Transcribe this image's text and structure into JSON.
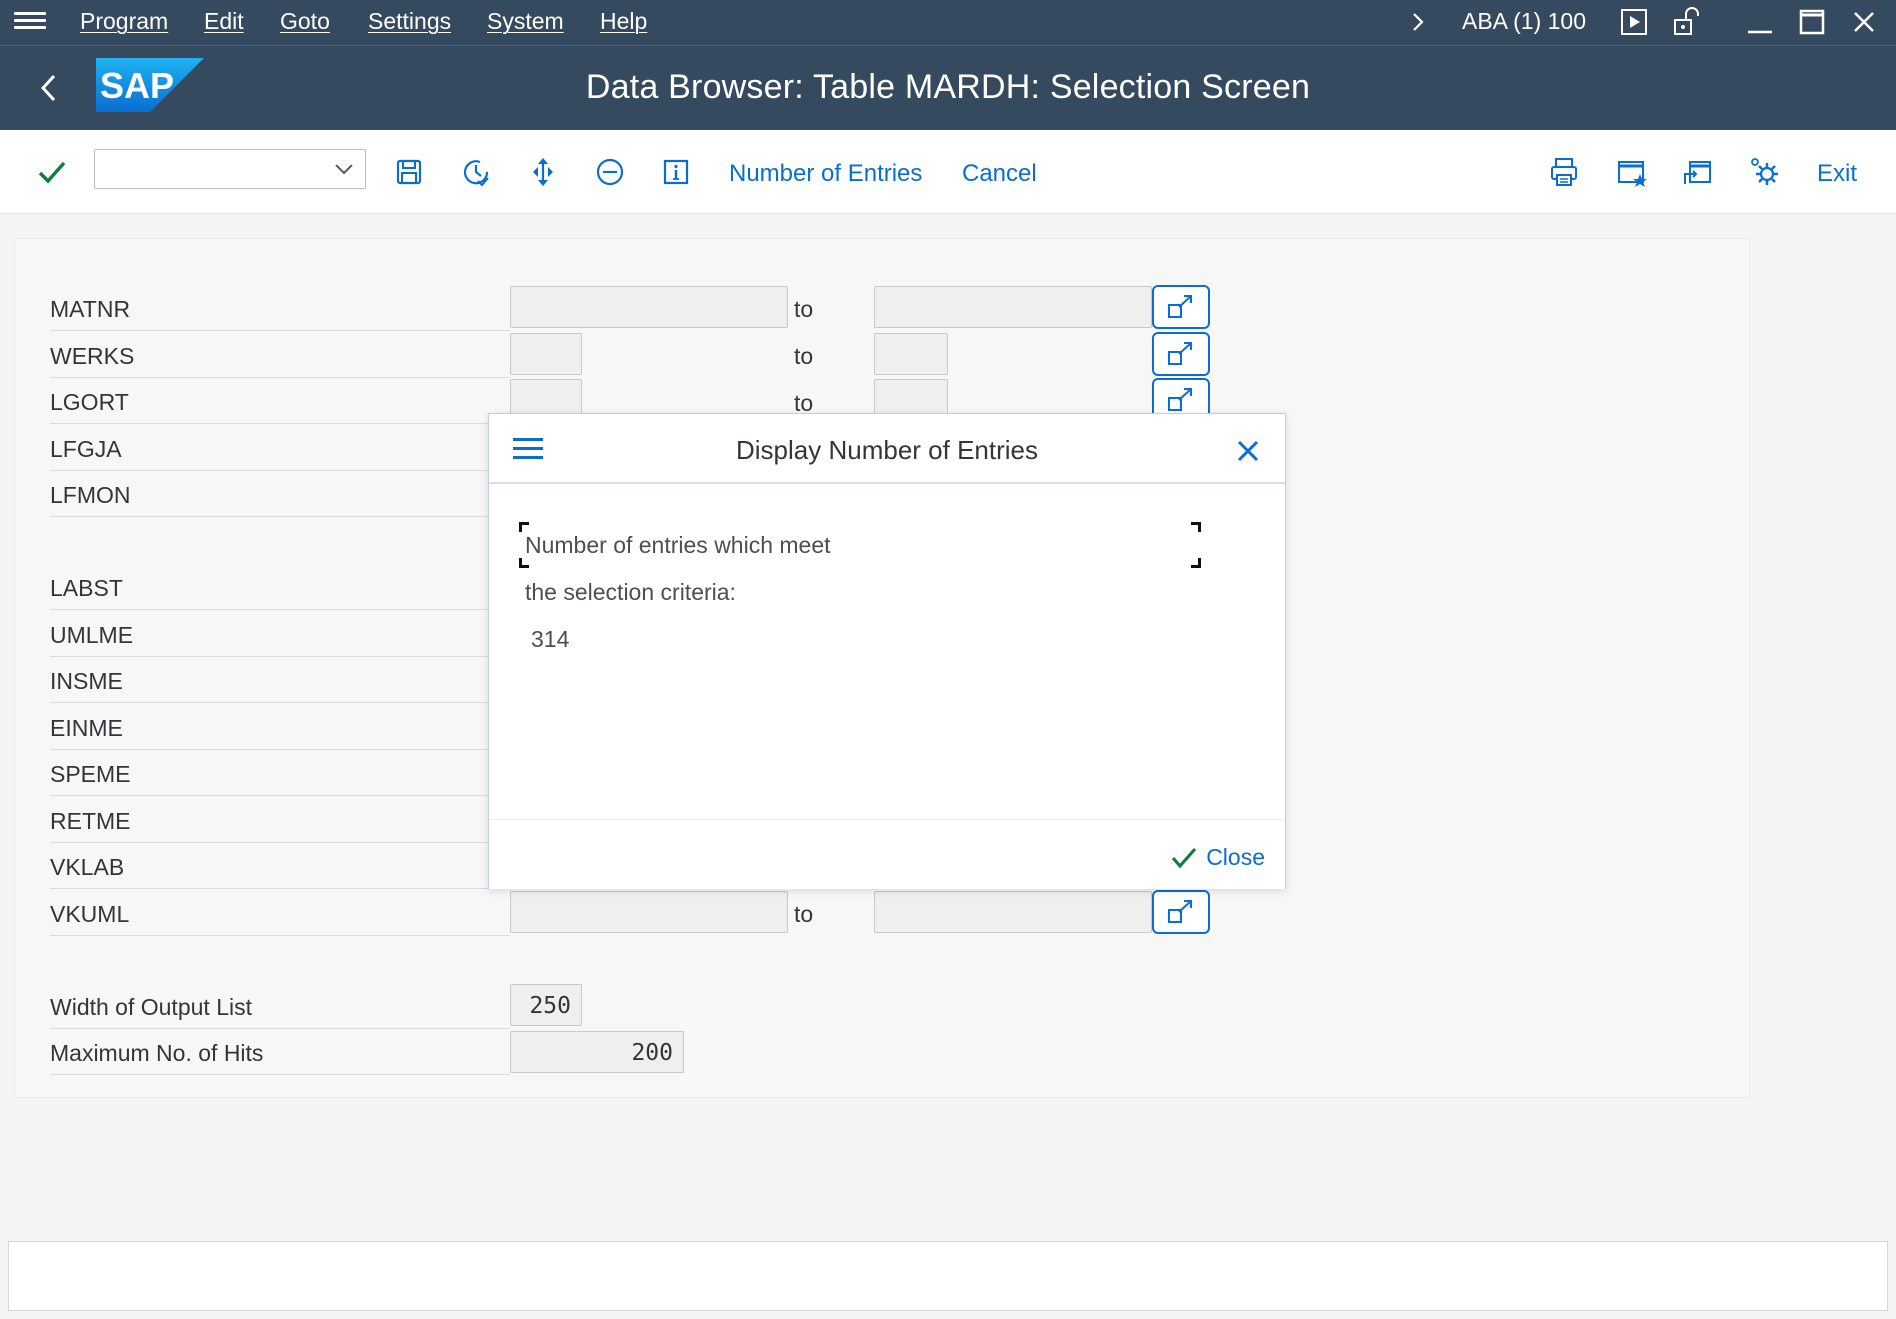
{
  "menubar": {
    "items": [
      "Program",
      "Edit",
      "Goto",
      "Settings",
      "System",
      "Help"
    ],
    "system_info": "ABA (1) 100"
  },
  "titlebar": {
    "title": "Data Browser: Table MARDH: Selection Screen"
  },
  "toolbar": {
    "command_value": "",
    "number_of_entries": "Number of Entries",
    "cancel": "Cancel",
    "exit": "Exit"
  },
  "form": {
    "to_label": "to",
    "fields": [
      {
        "label": "MATNR",
        "from": "",
        "to": ""
      },
      {
        "label": "WERKS",
        "from": "",
        "to": ""
      },
      {
        "label": "LGORT",
        "from": "",
        "to": ""
      },
      {
        "label": "LFGJA",
        "from": "",
        "to": ""
      },
      {
        "label": "LFMON",
        "from": "",
        "to": ""
      },
      {
        "label": "LABST",
        "from": "",
        "to": ""
      },
      {
        "label": "UMLME",
        "from": "",
        "to": ""
      },
      {
        "label": "INSME",
        "from": "",
        "to": ""
      },
      {
        "label": "EINME",
        "from": "",
        "to": ""
      },
      {
        "label": "SPEME",
        "from": "",
        "to": ""
      },
      {
        "label": "RETME",
        "from": "",
        "to": ""
      },
      {
        "label": "VKLAB",
        "from": "",
        "to": ""
      },
      {
        "label": "VKUML",
        "from": "",
        "to": ""
      }
    ],
    "width_of_output_list": {
      "label": "Width of Output List",
      "value": "250"
    },
    "max_hits": {
      "label": "Maximum No. of Hits",
      "value": "200"
    }
  },
  "dialog": {
    "title": "Display Number of Entries",
    "line1": "Number of entries which meet",
    "line2": "the selection criteria:",
    "count": "314",
    "close_label": "Close"
  },
  "colors": {
    "shell": "#354a5f",
    "accent": "#0a6ed1",
    "success": "#107e3e"
  },
  "icons": {
    "menu": "hamburger-icon",
    "back": "back-arrow-icon",
    "enter": "checkmark-icon",
    "save": "save-icon",
    "back_history": "history-icon",
    "navigate": "move-icon",
    "minus": "minus-circle-icon",
    "info": "info-icon",
    "print": "print-icon",
    "find": "find-icon",
    "find_next": "find-next-icon",
    "settings": "settings-icon",
    "multiple_selection": "multiple-selection-icon"
  }
}
